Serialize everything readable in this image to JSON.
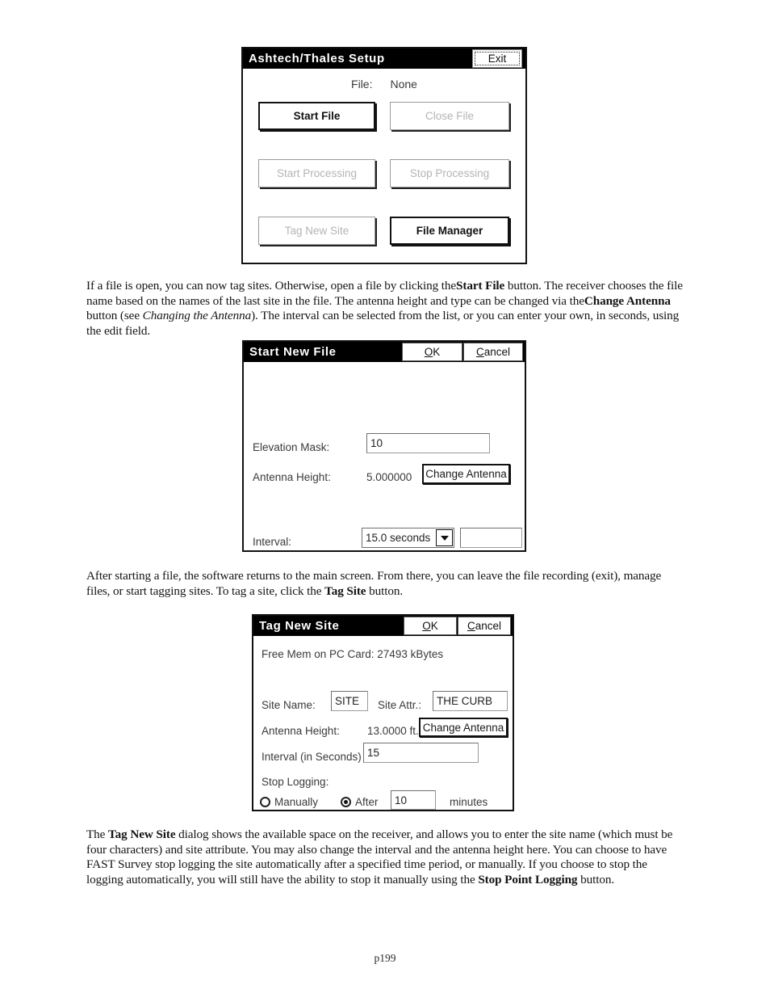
{
  "page": {
    "footer": "p199"
  },
  "dialog_setup": {
    "title": "Ashtech/Thales Setup",
    "exit_button": "Exit",
    "file_label": "File:",
    "file_value": "None",
    "buttons": [
      {
        "label": "Start File",
        "state": "enabled"
      },
      {
        "label": "Close File",
        "state": "disabled"
      },
      {
        "label": "Start Processing",
        "state": "disabled"
      },
      {
        "label": "Stop Processing",
        "state": "disabled"
      },
      {
        "label": "Tag New Site",
        "state": "disabled"
      },
      {
        "label": "File Manager",
        "state": "enabled"
      }
    ]
  },
  "paragraph_1": {
    "run_1": "If a file is open, you can now tag sites. Otherwise, open a file by clicking the",
    "run_2_bold": "Start File",
    "run_3": " button. The receiver chooses the file name based on the names of the last site in the file. The antenna height and type can be changed via the",
    "run_4_bold": "Change Antenna",
    "run_5": " button (see ",
    "run_6_italic": "Changing the Antenna",
    "run_7": "). The interval can be selected from the list, or you can enter your own, in seconds, using the edit field."
  },
  "dialog_start_new_file": {
    "title": "Start New File",
    "ok_button": {
      "mnemonic": "O",
      "rest": "K"
    },
    "cancel_button": {
      "mnemonic": "C",
      "rest": "ancel"
    },
    "elevation_mask_label": "Elevation Mask:",
    "elevation_mask_value": "10",
    "antenna_height_label": "Antenna Height:",
    "antenna_height_value": "5.000000",
    "change_antenna_button": "Change Antenna",
    "interval_label": "Interval:",
    "interval_selected": "15.0 seconds",
    "interval_custom_value": ""
  },
  "paragraph_2": {
    "run_1": "After starting a file, the software returns to the main screen. From there, you can leave the file recording (exit), manage files, or start tagging sites. To tag a site, click the ",
    "run_2_bold": "Tag Site",
    "run_3": " button."
  },
  "dialog_tag_new_site": {
    "title": "Tag New Site",
    "ok_button": {
      "mnemonic": "O",
      "rest": "K"
    },
    "cancel_button": {
      "mnemonic": "C",
      "rest": "ancel"
    },
    "free_mem_text": "Free Mem on PC Card: 27493 kBytes",
    "site_name_label": "Site Name:",
    "site_name_value": "SITE",
    "site_attr_label": "Site Attr.:",
    "site_attr_value": "THE CURB",
    "antenna_height_label": "Antenna Height:",
    "antenna_height_value": "13.0000 ft.",
    "change_antenna_button": "Change Antenna",
    "interval_label": "Interval (in Seconds)",
    "interval_value": "15",
    "stop_logging_label": "Stop Logging:",
    "radio_manually_label": "Manually",
    "radio_manually_checked": false,
    "radio_after_label": "After",
    "radio_after_checked": true,
    "after_minutes_value": "10",
    "minutes_label": "minutes"
  },
  "paragraph_3": {
    "run_1": "The ",
    "run_2_bold": "Tag New Site",
    "run_3": " dialog shows the available space on the receiver, and allows you to enter the site name (which must be four characters) and site attribute.  You may also change the interval and the antenna height here. You can choose to have FAST Survey stop logging the site automatically after a specified time period, or manually. If you choose to stop the logging automatically, you will still have the ability to stop it manually using the ",
    "run_4_bold": "Stop Point Logging",
    "run_5": " button."
  }
}
